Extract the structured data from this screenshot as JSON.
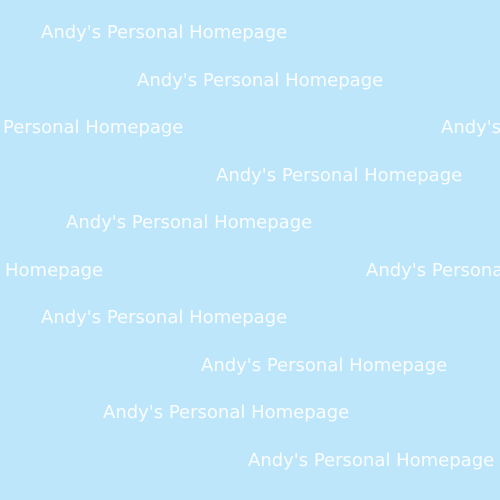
{
  "page": {
    "background_color": "#bee6fa",
    "text_color": "#ffffff",
    "text": "Andy's Personal Homepage",
    "rows": [
      {
        "text": "Andy's Personal Homepage"
      },
      {
        "text": "Andy's Personal Homepage"
      },
      {
        "text": "Personal Homepage",
        "wrap": "Andy's"
      },
      {
        "text": "Andy's Personal Homepage"
      },
      {
        "text": "Andy's Personal Homepage"
      },
      {
        "text": "Homepage",
        "wrap": "Andy's Personal"
      },
      {
        "text": "Andy's Personal Homepage"
      },
      {
        "text": "Andy's Personal Homepage"
      },
      {
        "text": "Andy's Personal Homepage"
      },
      {
        "text": "Andy's Personal Homepage"
      }
    ]
  }
}
